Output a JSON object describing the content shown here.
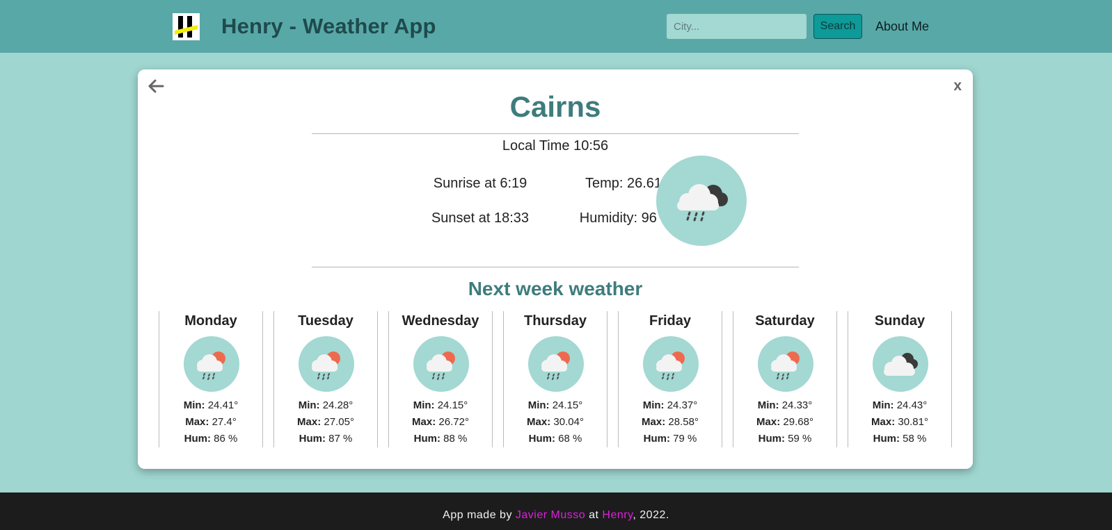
{
  "navbar": {
    "title": "Henry - Weather App",
    "search_placeholder": "City...",
    "search_label": "Search",
    "about_label": "About Me"
  },
  "card": {
    "close_label": "x",
    "city": "Cairns",
    "local_time": "Local Time 10:56",
    "sunrise": "Sunrise at 6:19",
    "sunset": "Sunset at 18:33",
    "temp": "Temp: 26.61°",
    "humidity": "Humidity: 96 %",
    "main_icon": "rain-cloud-icon",
    "week_title": "Next week weather",
    "labels": {
      "min": "Min:",
      "max": "Max:",
      "hum": "Hum:"
    },
    "days": [
      {
        "name": "Monday",
        "icon": "sun-rain-cloud-icon",
        "min": "24.41°",
        "max": "27.4°",
        "hum": "86 %"
      },
      {
        "name": "Tuesday",
        "icon": "sun-rain-cloud-icon",
        "min": "24.28°",
        "max": "27.05°",
        "hum": "87 %"
      },
      {
        "name": "Wednesday",
        "icon": "sun-rain-cloud-icon",
        "min": "24.15°",
        "max": "26.72°",
        "hum": "88 %"
      },
      {
        "name": "Thursday",
        "icon": "sun-rain-cloud-icon",
        "min": "24.15°",
        "max": "30.04°",
        "hum": "68 %"
      },
      {
        "name": "Friday",
        "icon": "sun-rain-cloud-icon",
        "min": "24.37°",
        "max": "28.58°",
        "hum": "79 %"
      },
      {
        "name": "Saturday",
        "icon": "sun-rain-cloud-icon",
        "min": "24.33°",
        "max": "29.68°",
        "hum": "59 %"
      },
      {
        "name": "Sunday",
        "icon": "cloudy-icon",
        "min": "24.43°",
        "max": "30.81°",
        "hum": "58 %"
      }
    ]
  },
  "footer": {
    "prefix": "App made by",
    "author": "Javier Musso",
    "middle": "at",
    "org": "Henry",
    "suffix": ", 2022."
  },
  "colors": {
    "page_bg": "#a0d6d0",
    "navbar_bg": "#58a8a8",
    "accent": "#3e7c7d",
    "button": "#0d9a98",
    "footer_link": "#e01fe0"
  }
}
